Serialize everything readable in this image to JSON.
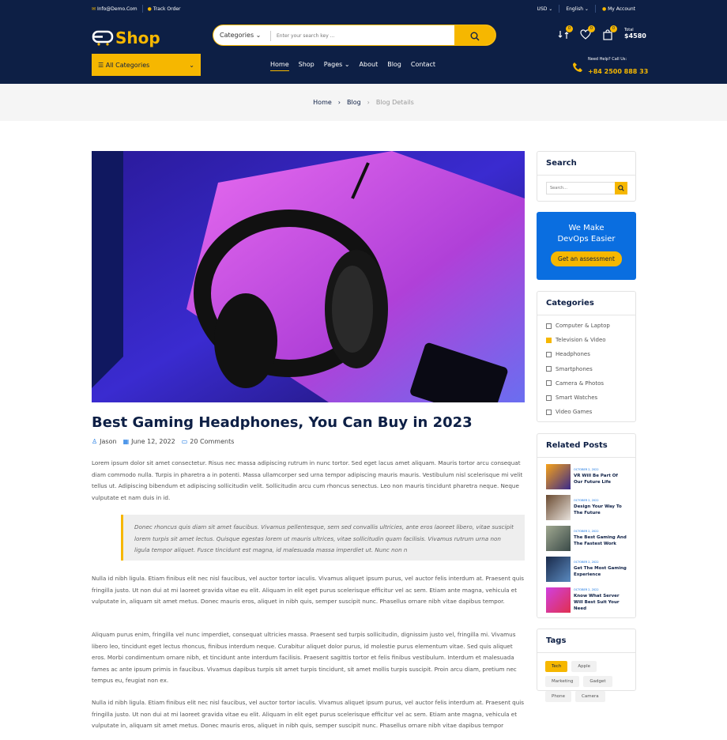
{
  "topbar": {
    "email": "Info@Demo.Com",
    "track": "Track Order",
    "currency": "USD",
    "language": "English",
    "account": "My Account"
  },
  "header": {
    "logo_a": "E",
    "logo_shop": "Shop",
    "search_category": "Categories",
    "search_placeholder": "Enter your search key ...",
    "compare_count": "0",
    "wishlist_count": "0",
    "cart_count": "0",
    "total_label": "Total",
    "total_amount": "$4580",
    "all_categories": "All Categories",
    "help_label": "Need Help? Call Us:",
    "help_phone": "+84 2500 888 33"
  },
  "nav": [
    "Home",
    "Shop",
    "Pages",
    "About",
    "Blog",
    "Contact"
  ],
  "breadcrumb": {
    "home": "Home",
    "blog": "Blog",
    "current": "Blog Details"
  },
  "post": {
    "title": "Best Gaming Headphones, You Can Buy in 2023",
    "author": "Jason",
    "date": "June 12, 2022",
    "comments": "20 Comments",
    "p1": "Lorem ipsum dolor sit amet consectetur. Risus nec massa adipiscing rutrum in nunc tortor. Sed eget lacus amet aliquam. Mauris tortor arcu consequat diam commodo nulla. Turpis in pharetra a in potenti. Massa ullamcorper sed urna tempor adipiscing mauris mauris. Vestibulum nisl scelerisque mi velit tellus ut. Adipiscing bibendum et adipiscing sollicitudin velit. Sollicitudin arcu cum rhoncus senectus. Leo non mauris tincidunt pharetra neque. Neque vulputate et nam duis in id.",
    "quote": "Donec rhoncus quis diam sit amet faucibus. Vivamus pellentesque, sem sed convallis ultricies, ante eros laoreet libero, vitae suscipit lorem turpis sit amet lectus. Quisque egestas lorem ut mauris ultrices, vitae sollicitudin quam facilisis. Vivamus rutrum urna non ligula tempor aliquet. Fusce tincidunt est magna, id malesuada massa imperdiet ut. Nunc non n",
    "p2": "Nulla id nibh ligula. Etiam finibus elit nec nisl faucibus, vel auctor tortor iaculis. Vivamus aliquet ipsum purus, vel auctor felis interdum at. Praesent quis fringilla justo. Ut non dui at mi laoreet gravida vitae eu elit. Aliquam in elit eget purus scelerisque efficitur vel ac sem. Etiam ante magna, vehicula et vulputate in, aliquam sit amet metus. Donec mauris eros, aliquet in nibh quis, semper suscipit nunc. Phasellus ornare nibh vitae dapibus tempor.",
    "p3": "Aliquam purus enim, fringilla vel nunc imperdiet, consequat ultricies massa. Praesent sed turpis sollicitudin, dignissim justo vel, fringilla mi. Vivamus libero leo, tincidunt eget lectus rhoncus, finibus interdum neque. Curabitur aliquet dolor purus, id molestie purus elementum vitae. Sed quis aliquet eros. Morbi condimentum ornare nibh, et tincidunt ante interdum facilisis. Praesent sagittis tortor et felis finibus vestibulum. Interdum et malesuada fames ac ante ipsum primis in faucibus. Vivamus dapibus turpis sit amet turpis tincidunt, sit amet mollis turpis suscipit. Proin arcu diam, pretium nec tempus eu, feugiat non ex.",
    "p4": "Nulla id nibh ligula. Etiam finibus elit nec nisl faucibus, vel auctor tortor iaculis. Vivamus aliquet ipsum purus, vel auctor felis interdum at. Praesent quis fringilla justo. Ut non dui at mi laoreet gravida vitae eu elit. Aliquam in elit eget purus scelerisque efficitur vel ac sem. Etiam ante magna, vehicula et vulputate in, aliquam sit amet metus. Donec mauris eros, aliquet in nibh quis, semper suscipit nunc. Phasellus ornare nibh vitae dapibus tempor"
  },
  "sidebar": {
    "search_title": "Search",
    "search_placeholder": "Search...",
    "promo_line1": "We Make",
    "promo_line2": "DevOps Easier",
    "promo_button": "Get an assessment",
    "categories_title": "Categories",
    "categories": [
      "Computer & Laptop",
      "Television & Video",
      "Headphones",
      "Smartphones",
      "Camera & Photos",
      "Smart Watches",
      "Video Games"
    ],
    "related_title": "Related Posts",
    "related": [
      {
        "date": "OCTOBER 2, 2022",
        "title": "VR Will Be Part Of Our Future Life"
      },
      {
        "date": "OCTOBER 2, 2022",
        "title": "Design Your Way To The Future"
      },
      {
        "date": "OCTOBER 2, 2022",
        "title": "The Best Gaming And The Fastest Work"
      },
      {
        "date": "OCTOBER 2, 2022",
        "title": "Get The Most Gaming Experience"
      },
      {
        "date": "OCTOBER 2, 2022",
        "title": "Know What Server Will Best Suit Your Need"
      }
    ],
    "tags_title": "Tags",
    "tags": [
      "Tech",
      "Apple",
      "Marketing",
      "Gadget",
      "Phone",
      "Camera"
    ]
  },
  "colors": {
    "navy": "#0d1f45",
    "accent": "#f6b700",
    "blue": "#0a6ee0"
  }
}
